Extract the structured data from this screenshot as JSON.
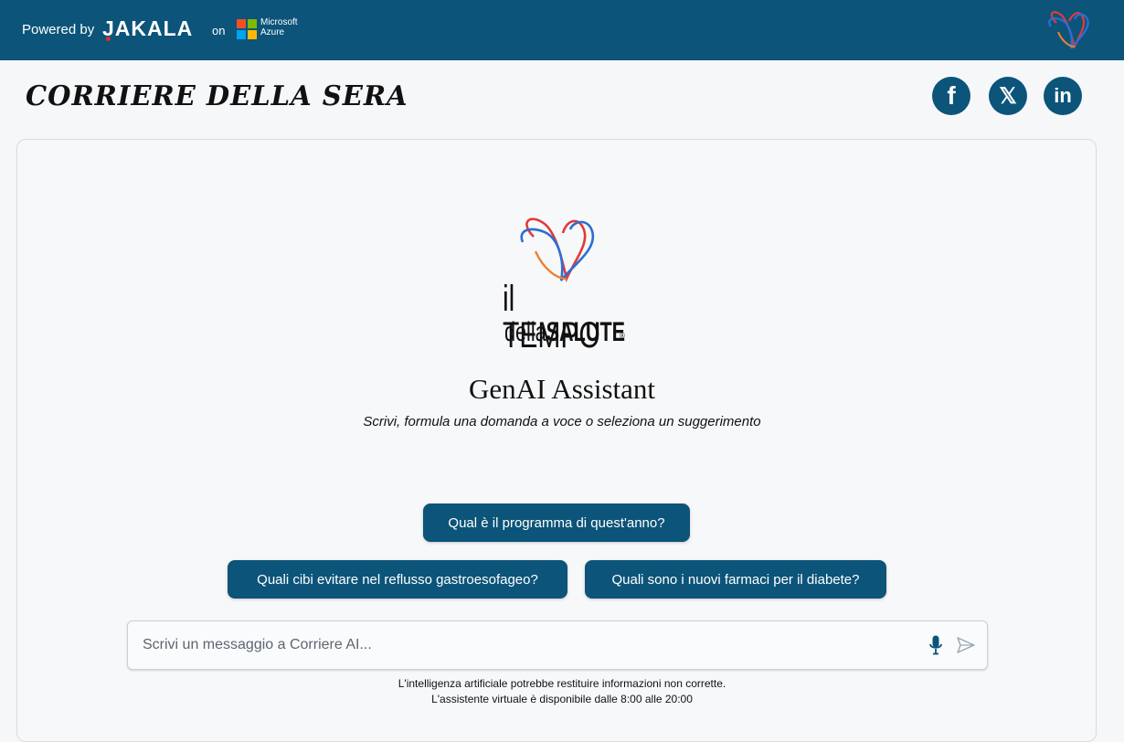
{
  "topbar": {
    "powered_by": "Powered by",
    "jakala": "JAKALA",
    "on": "on",
    "ms_line1": "Microsoft",
    "ms_line2": "Azure",
    "bg_color": "#0c5479"
  },
  "header": {
    "brand": "CORRIERE DELLA SERA",
    "social": [
      "facebook-icon",
      "x-icon",
      "linkedin-icon"
    ]
  },
  "main": {
    "logo_line1": "il TEMPO",
    "logo_line2_a": "della",
    "logo_line2_b": "SALUTE",
    "logo_reg": "®",
    "title": "GenAI Assistant",
    "subtitle": "Scrivi, formula una domanda a voce o seleziona un suggerimento",
    "suggestions": [
      "Qual è il programma di quest'anno?",
      "Quali cibi evitare nel reflusso gastroesofageo?",
      "Quali sono i nuovi farmaci per il diabete?"
    ],
    "input_placeholder": "Scrivi un messaggio a Corriere AI...",
    "disclaimer_line1": "L'intelligenza artificiale potrebbe restituire informazioni non corrette.",
    "disclaimer_line2": "L'assistente virtuale è disponibile dalle 8:00 alle 20:00"
  }
}
